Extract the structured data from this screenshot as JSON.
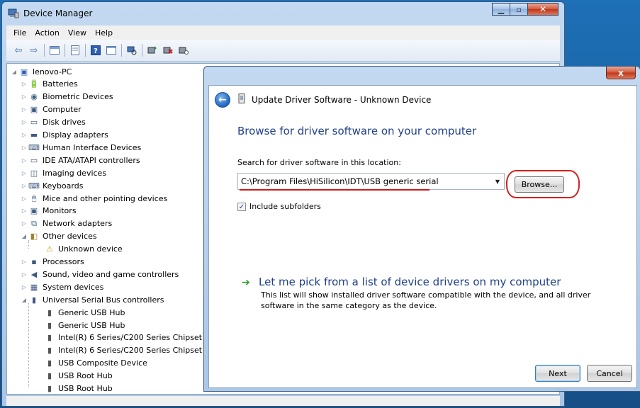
{
  "window": {
    "title": "Device Manager"
  },
  "menu": [
    "File",
    "Action",
    "View",
    "Help"
  ],
  "toolbar_icons": [
    "back-icon",
    "forward-icon",
    "properties-icon",
    "console-tree-icon",
    "help-icon",
    "view-icon",
    "scan-hardware-icon",
    "update-driver-icon",
    "uninstall-icon",
    "disable-icon"
  ],
  "tree": {
    "root": "lenovo-PC",
    "categories": [
      {
        "label": "Batteries",
        "icon": "battery-icon",
        "state": "collapsed"
      },
      {
        "label": "Biometric Devices",
        "icon": "biometric-icon",
        "state": "collapsed"
      },
      {
        "label": "Computer",
        "icon": "computer-icon",
        "state": "collapsed"
      },
      {
        "label": "Disk drives",
        "icon": "disk-icon",
        "state": "collapsed"
      },
      {
        "label": "Display adapters",
        "icon": "display-icon",
        "state": "collapsed"
      },
      {
        "label": "Human Interface Devices",
        "icon": "hid-icon",
        "state": "collapsed"
      },
      {
        "label": "IDE ATA/ATAPI controllers",
        "icon": "ide-icon",
        "state": "collapsed"
      },
      {
        "label": "Imaging devices",
        "icon": "imaging-icon",
        "state": "collapsed"
      },
      {
        "label": "Keyboards",
        "icon": "keyboard-icon",
        "state": "collapsed"
      },
      {
        "label": "Mice and other pointing devices",
        "icon": "mouse-icon",
        "state": "collapsed"
      },
      {
        "label": "Monitors",
        "icon": "monitor-icon",
        "state": "collapsed"
      },
      {
        "label": "Network adapters",
        "icon": "network-icon",
        "state": "collapsed"
      },
      {
        "label": "Other devices",
        "icon": "other-devices-icon",
        "state": "expanded",
        "children": [
          "Unknown device"
        ]
      },
      {
        "label": "Processors",
        "icon": "processor-icon",
        "state": "collapsed"
      },
      {
        "label": "Sound, video and game controllers",
        "icon": "sound-icon",
        "state": "collapsed"
      },
      {
        "label": "System devices",
        "icon": "system-icon",
        "state": "collapsed"
      },
      {
        "label": "Universal Serial Bus controllers",
        "icon": "usb-icon",
        "state": "expanded",
        "children": [
          "Generic USB Hub",
          "Generic USB Hub",
          "Intel(R) 6 Series/C200 Series Chipset",
          "Intel(R) 6 Series/C200 Series Chipset",
          "USB Composite Device",
          "USB Root Hub",
          "USB Root Hub"
        ]
      }
    ]
  },
  "dialog": {
    "title": "Update Driver Software - Unknown Device",
    "heading": "Browse for driver software on your computer",
    "search_label": "Search for driver software in this location:",
    "path_value": "C:\\Program Files\\HiSilicon\\IDT\\USB generic serial",
    "browse_label": "Browse...",
    "include_subfolders_label": "Include subfolders",
    "include_subfolders_checked": true,
    "pick_title": "Let me pick from a list of device drivers on my computer",
    "pick_description": "This list will show installed driver software compatible with the device, and all driver software in the same category as the device.",
    "next_label": "Next",
    "cancel_label": "Cancel",
    "close_label": "x"
  },
  "colors": {
    "heading_blue": "#1e3f8a",
    "annotation_red": "#d42020",
    "link_arrow_green": "#2a9a2a"
  }
}
